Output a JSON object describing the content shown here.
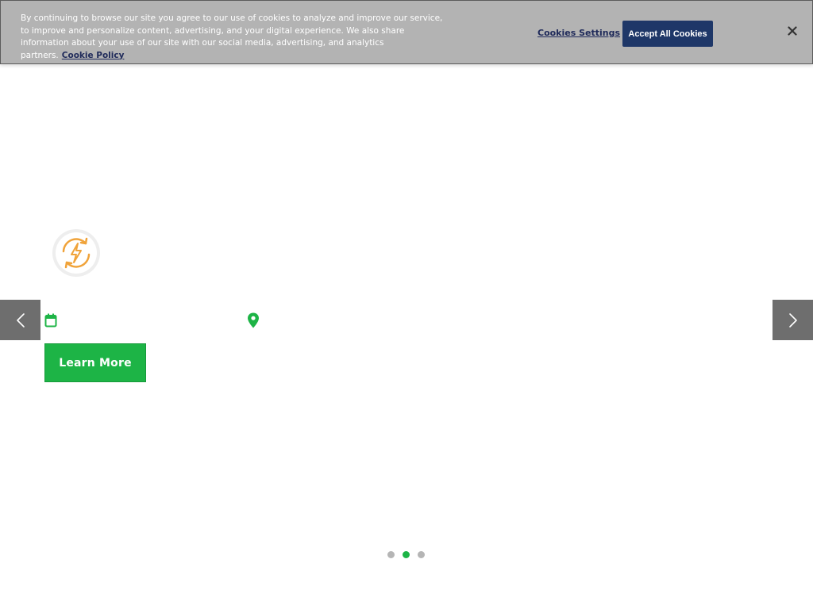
{
  "cookie_banner": {
    "message": "By continuing to browse our site you agree to our use of cookies to analyze and improve our service, to improve and personalize content, advertising, and your digital experience. We also share information about your use of our site with our social media, advertising, and analytics partners.",
    "policy_link": "Cookie Policy",
    "settings_label": "Cookies Settings",
    "accept_label": "Accept All Cookies",
    "close_icon": "close-icon",
    "colors": {
      "background": "#b3b3b3",
      "accept_button": "#1e3768",
      "link": "#1f2a5a"
    }
  },
  "hero": {
    "feature_icon": "energy-refresh-icon",
    "date_icon": "calendar-icon",
    "location_icon": "map-pin-icon",
    "date_text": "",
    "location_text": "",
    "cta_label": "Learn More",
    "colors": {
      "accent": "#1db446",
      "icon_orange": "#f0a33a",
      "arrow_bg": "#6e6e6e"
    }
  },
  "slider": {
    "prev_icon": "chevron-left-icon",
    "next_icon": "chevron-right-icon",
    "slide_count": 3,
    "active_slide": 2
  }
}
